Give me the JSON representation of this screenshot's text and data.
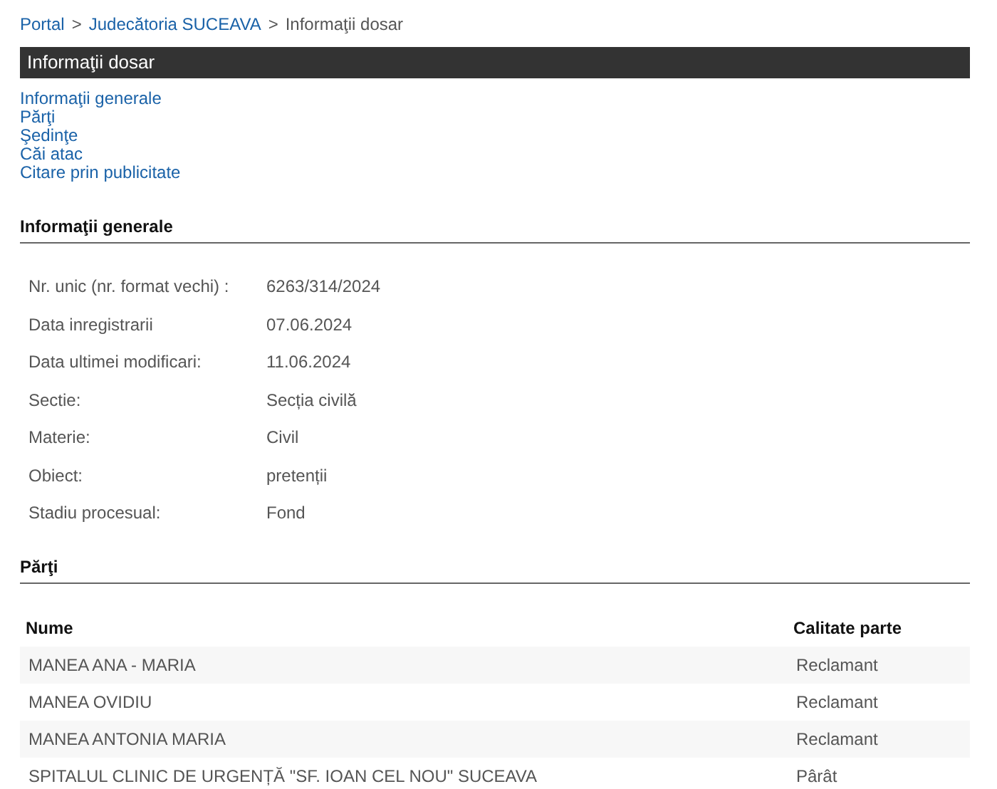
{
  "breadcrumb": {
    "separator": ">",
    "items": [
      {
        "label": "Portal",
        "kind": "link"
      },
      {
        "label": "Judecătoria SUCEAVA",
        "kind": "link"
      },
      {
        "label": "Informaţii dosar",
        "kind": "current"
      }
    ]
  },
  "page_title": "Informaţii dosar",
  "nav_links": [
    "Informaţii generale",
    "Părţi",
    "Şedinţe",
    "Căi atac",
    "Citare prin publicitate"
  ],
  "general": {
    "title": "Informaţii generale",
    "rows": [
      {
        "label": "Nr. unic (nr. format vechi) :",
        "value": "6263/314/2024"
      },
      {
        "label": "Data inregistrarii",
        "value": "07.06.2024"
      },
      {
        "label": "Data ultimei modificari:",
        "value": "11.06.2024"
      },
      {
        "label": "Sectie:",
        "value": "Secția civilă"
      },
      {
        "label": "Materie:",
        "value": "Civil"
      },
      {
        "label": "Obiect:",
        "value": "pretenții"
      },
      {
        "label": "Stadiu procesual:",
        "value": "Fond"
      }
    ]
  },
  "parties": {
    "title": "Părţi",
    "columns": [
      "Nume",
      "Calitate parte"
    ],
    "rows": [
      {
        "name": "MANEA ANA - MARIA",
        "role": "Reclamant"
      },
      {
        "name": "MANEA OVIDIU",
        "role": "Reclamant"
      },
      {
        "name": "MANEA ANTONIA MARIA",
        "role": "Reclamant"
      },
      {
        "name": "SPITALUL CLINIC DE URGENȚĂ \"SF. IOAN CEL NOU\" SUCEAVA",
        "role": "Pârât"
      }
    ]
  }
}
